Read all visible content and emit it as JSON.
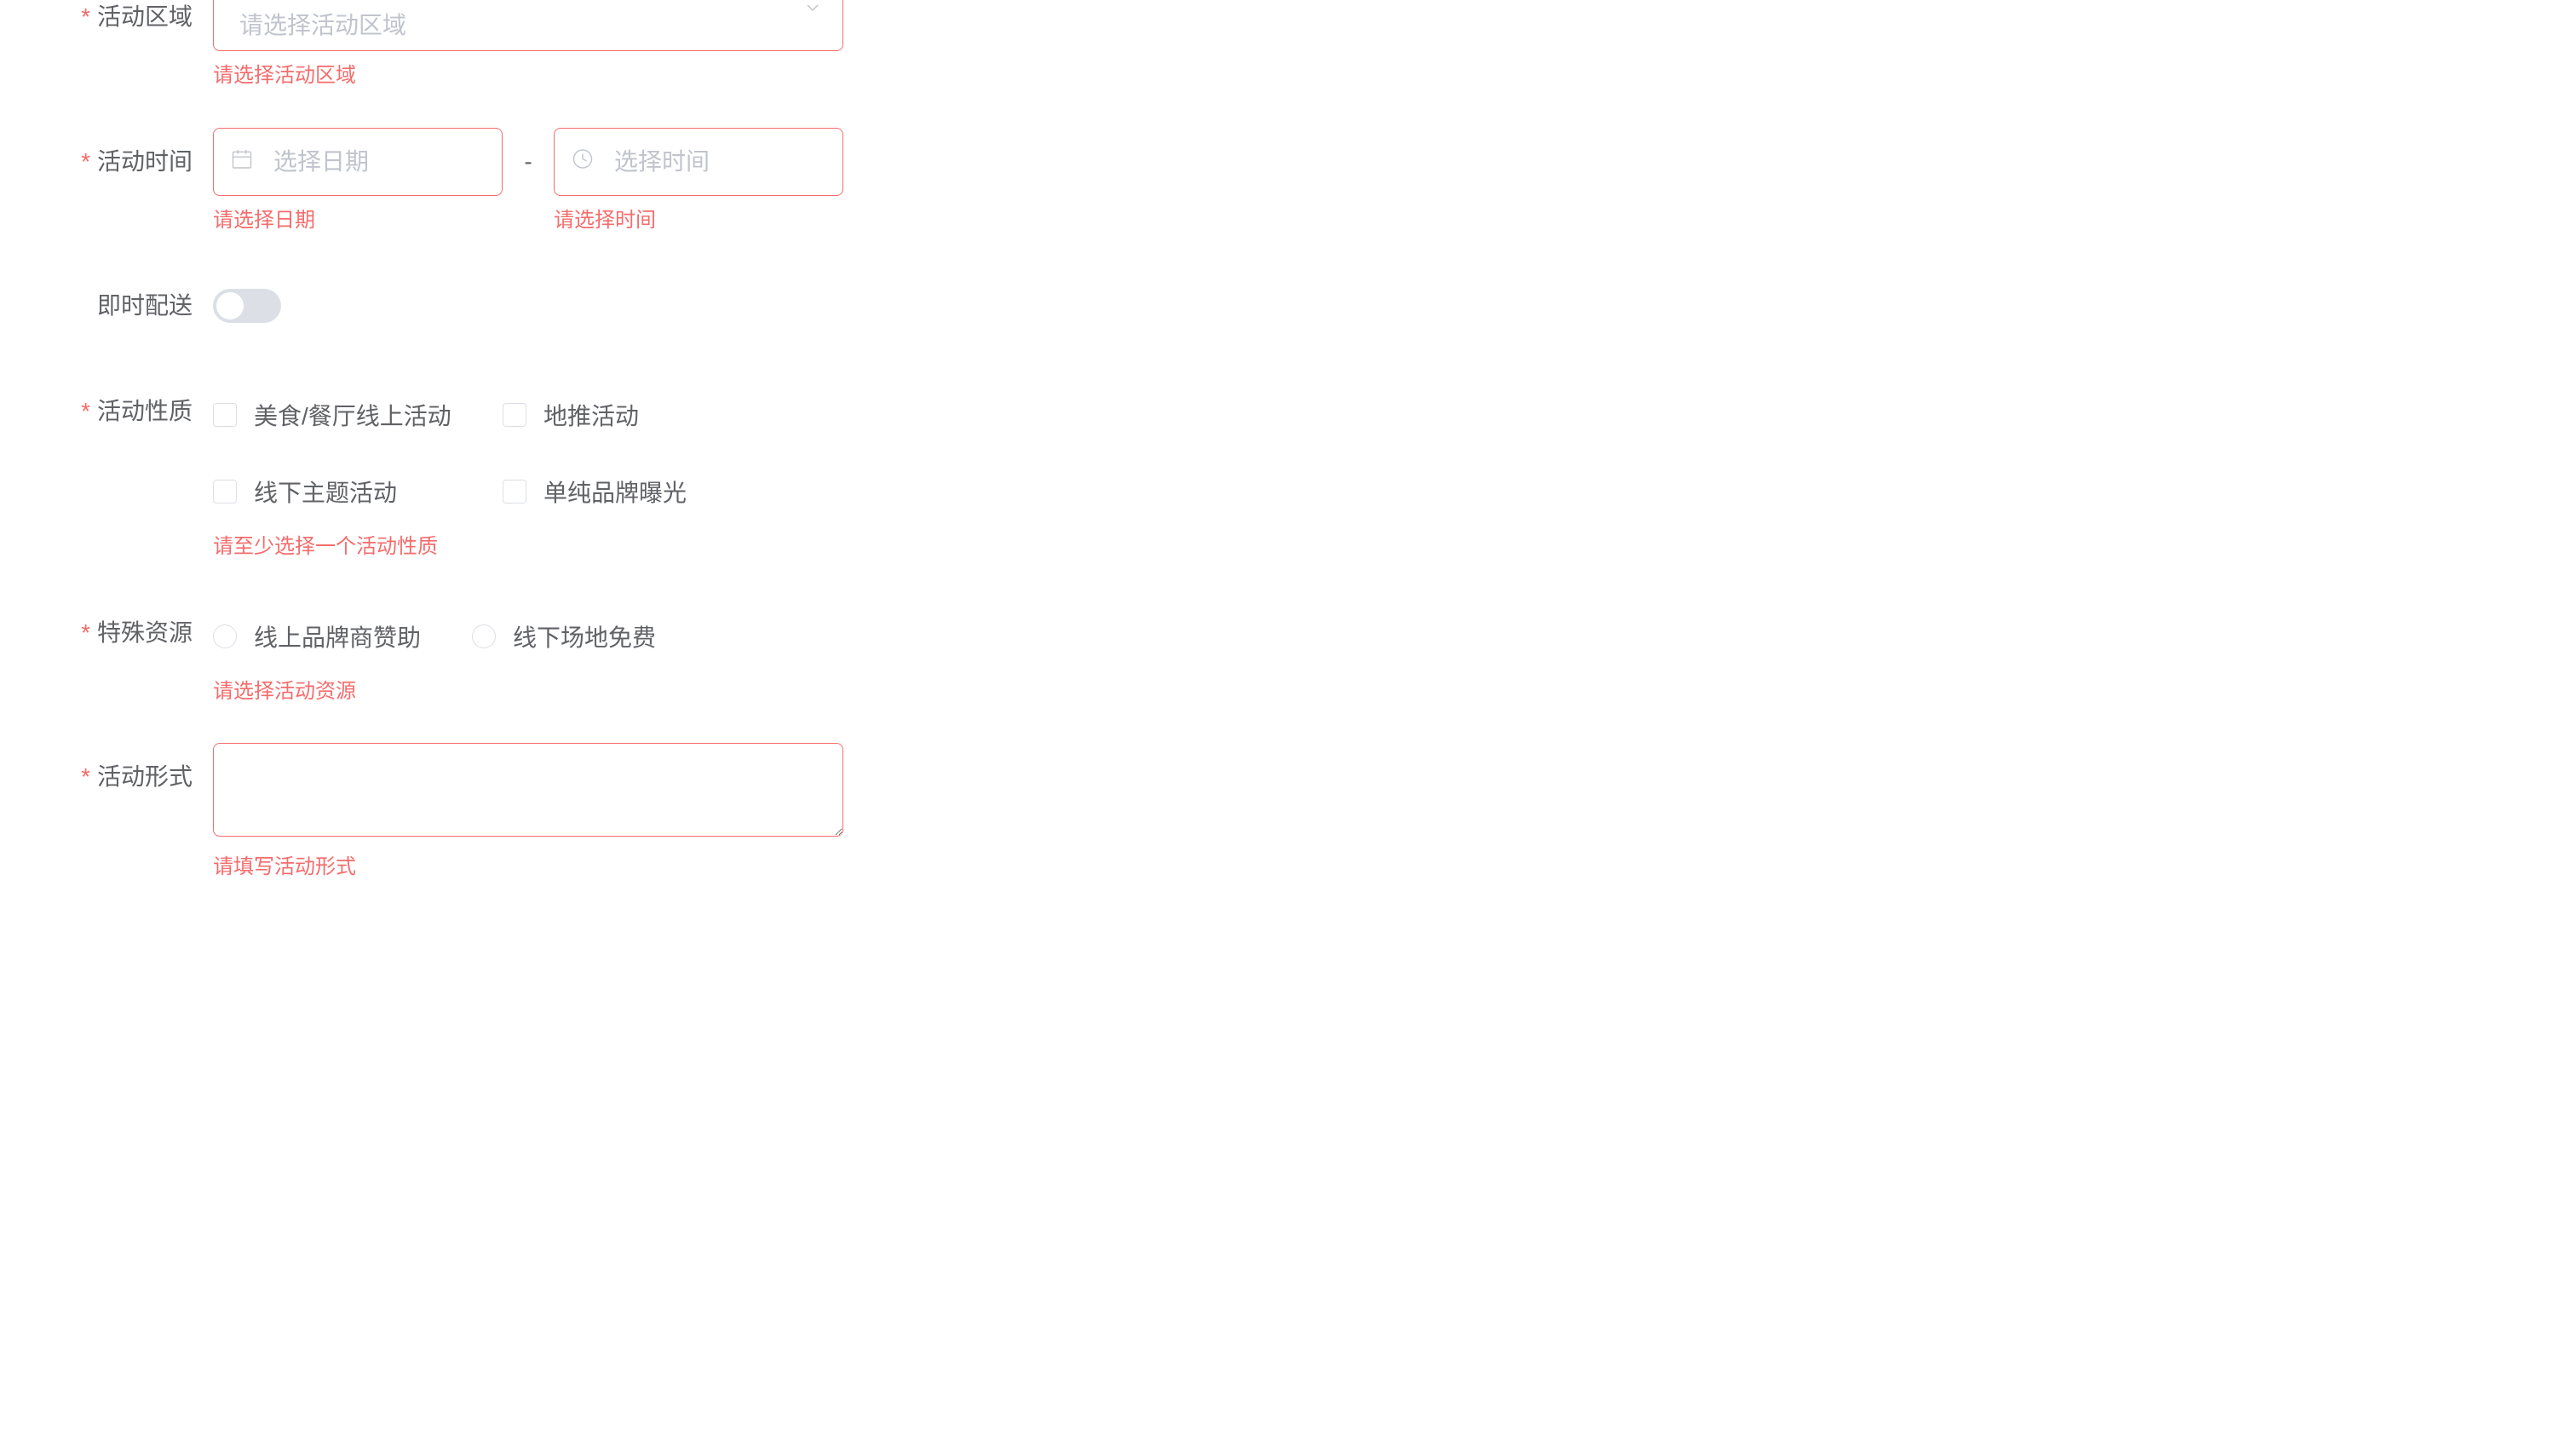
{
  "region": {
    "label": "活动区域",
    "placeholder": "请选择活动区域",
    "error": "请选择活动区域"
  },
  "datetime": {
    "label": "活动时间",
    "date_placeholder": "选择日期",
    "time_placeholder": "选择时间",
    "separator": "-",
    "date_error": "请选择日期",
    "time_error": "请选择时间"
  },
  "delivery": {
    "label": "即时配送"
  },
  "nature": {
    "label": "活动性质",
    "options": [
      "美食/餐厅线上活动",
      "地推活动",
      "线下主题活动",
      "单纯品牌曝光"
    ],
    "error": "请至少选择一个活动性质"
  },
  "resource": {
    "label": "特殊资源",
    "options": [
      "线上品牌商赞助",
      "线下场地免费"
    ],
    "error": "请选择活动资源"
  },
  "form": {
    "label": "活动形式",
    "error": "请填写活动形式"
  }
}
